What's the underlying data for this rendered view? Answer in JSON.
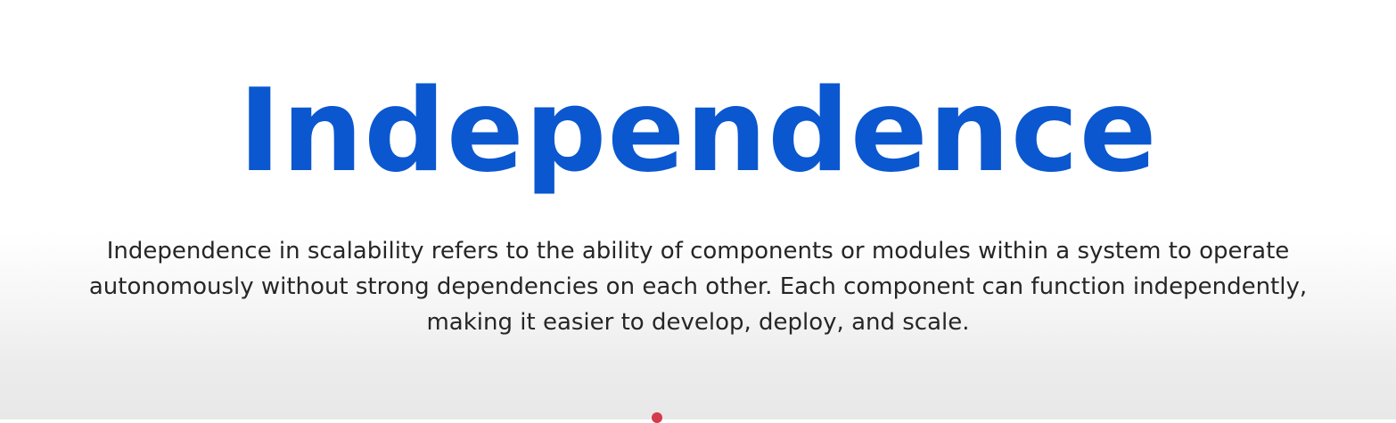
{
  "slide": {
    "title": "Independence",
    "body_lines": [
      "Independence in scalability refers to the ability of components or modules within a system to operate",
      "autonomously without strong dependencies on each other. Each component can function independently,",
      "making it easier to develop, deploy, and scale."
    ]
  },
  "colors": {
    "title": "#0b57d0",
    "body_text": "#262626",
    "accent": "#d33a4a"
  }
}
